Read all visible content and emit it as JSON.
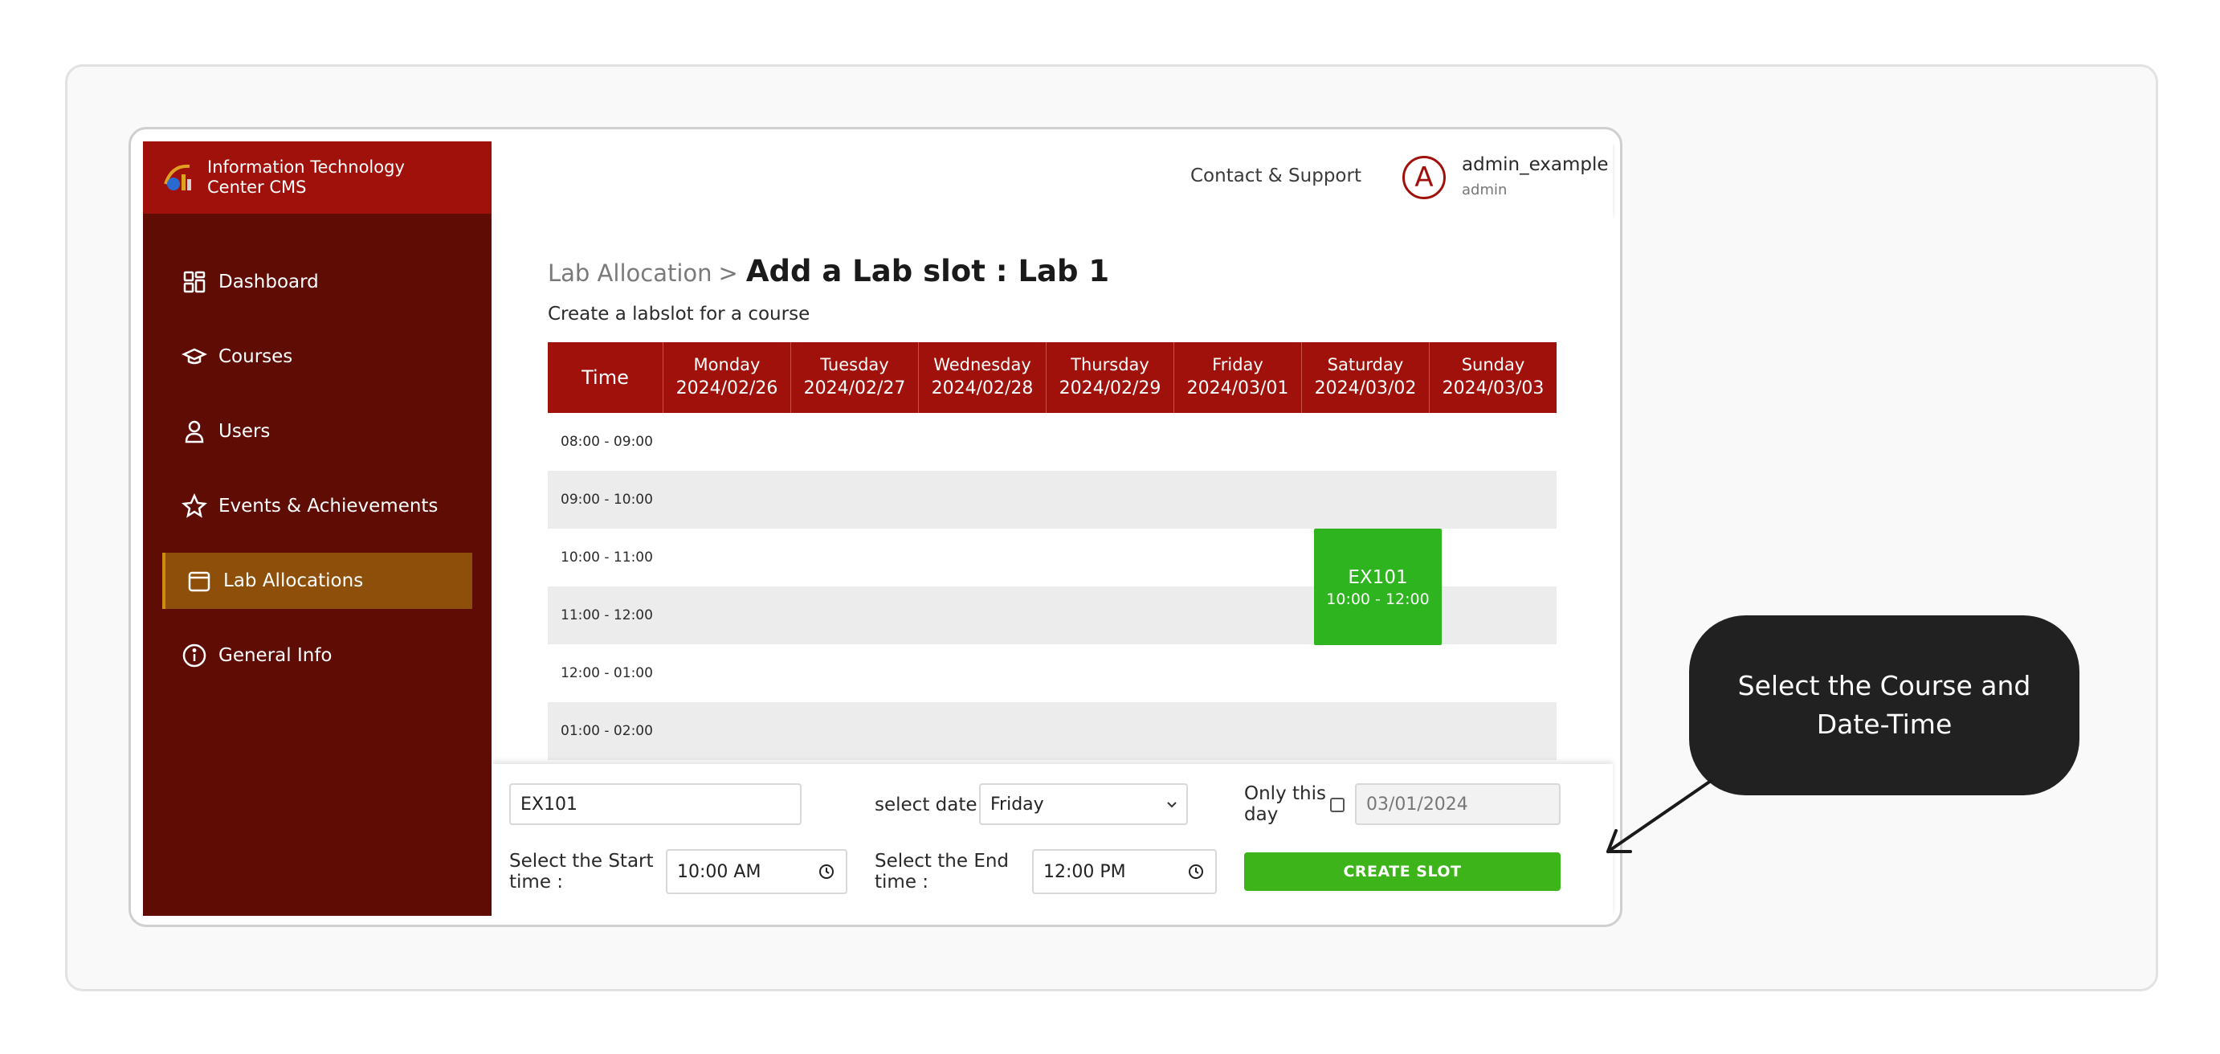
{
  "brand": {
    "title": "Information Technology Center CMS"
  },
  "sidebar": {
    "items": [
      {
        "label": "Dashboard",
        "icon": "dashboard-icon"
      },
      {
        "label": "Courses",
        "icon": "graduation-cap-icon"
      },
      {
        "label": "Users",
        "icon": "user-icon"
      },
      {
        "label": "Events & Achievements",
        "icon": "star-icon"
      },
      {
        "label": "Lab Allocations",
        "icon": "calendar-icon",
        "active": true
      },
      {
        "label": "General Info",
        "icon": "info-icon"
      }
    ]
  },
  "header": {
    "contact": "Contact & Support",
    "avatar_letter": "A",
    "user_name": "admin_example",
    "user_role": "admin"
  },
  "page": {
    "breadcrumb_parent": "Lab Allocation",
    "breadcrumb_sep": ">",
    "title": "Add a Lab slot : Lab 1",
    "subtitle": "Create a labslot for a course"
  },
  "schedule": {
    "time_header": "Time",
    "days": [
      {
        "name": "Monday",
        "date": "2024/02/26"
      },
      {
        "name": "Tuesday",
        "date": "2024/02/27"
      },
      {
        "name": "Wednesday",
        "date": "2024/02/28"
      },
      {
        "name": "Thursday",
        "date": "2024/02/29"
      },
      {
        "name": "Friday",
        "date": "2024/03/01"
      },
      {
        "name": "Saturday",
        "date": "2024/03/02"
      },
      {
        "name": "Sunday",
        "date": "2024/03/03"
      }
    ],
    "times": [
      "08:00 - 09:00",
      "09:00 - 10:00",
      "10:00 - 11:00",
      "11:00 - 12:00",
      "12:00 - 01:00",
      "01:00 - 02:00"
    ],
    "slot": {
      "code": "EX101",
      "time": "10:00 - 12:00",
      "color": "#2db41e"
    }
  },
  "form": {
    "course_value": "EX101",
    "date_label": "select date",
    "date_value": "Friday",
    "only_day_label": "Only this day",
    "only_day_checked": false,
    "specific_date": "03/01/2024",
    "start_label": "Select the Start time :",
    "start_value": "10:00 AM",
    "end_label": "Select the End time :",
    "end_value": "12:00 PM",
    "create_label": "CREATE SLOT"
  },
  "callout": {
    "text": "Select the Course and Date-Time"
  },
  "colors": {
    "primary": "#a0110b",
    "sidebar": "#5f0c05",
    "active": "#8e4f0a",
    "success": "#3db41a"
  }
}
